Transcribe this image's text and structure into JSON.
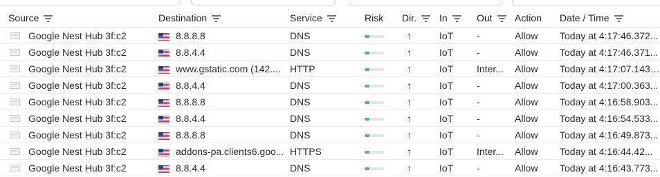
{
  "columns": {
    "source": "Source",
    "destination": "Destination",
    "service": "Service",
    "risk": "Risk",
    "direction": "Dir.",
    "in": "In",
    "out": "Out",
    "action": "Action",
    "datetime": "Date / Time"
  },
  "icons": {
    "filter": "filter-icon",
    "device": "device-icon",
    "flag": "us-flag-icon",
    "direction": "arrow-up-icon"
  },
  "colors": {
    "risk_fill": "#39c45c",
    "risk_track": "#e4e4e4"
  },
  "rows": [
    {
      "source": "Google Nest Hub 3f:c2",
      "destination": "8.8.8.8",
      "service": "DNS",
      "risk": 0.25,
      "direction": "↑",
      "in": "IoT",
      "out": "-",
      "action": "Allow",
      "datetime": "Today at 4:17:46.372..."
    },
    {
      "source": "Google Nest Hub 3f:c2",
      "destination": "8.8.4.4",
      "service": "DNS",
      "risk": 0.25,
      "direction": "↑",
      "in": "IoT",
      "out": "-",
      "action": "Allow",
      "datetime": "Today at 4:17:46.371..."
    },
    {
      "source": "Google Nest Hub 3f:c2",
      "destination": "www.gstatic.com (142....",
      "service": "HTTP",
      "risk": 0.25,
      "direction": "↑",
      "in": "IoT",
      "out": "Inter...",
      "action": "Allow",
      "datetime": "Today at 4:17:07.143 ..."
    },
    {
      "source": "Google Nest Hub 3f:c2",
      "destination": "8.8.4.4",
      "service": "DNS",
      "risk": 0.25,
      "direction": "↑",
      "in": "IoT",
      "out": "-",
      "action": "Allow",
      "datetime": "Today at 4:17:00.363..."
    },
    {
      "source": "Google Nest Hub 3f:c2",
      "destination": "8.8.8.8",
      "service": "DNS",
      "risk": 0.25,
      "direction": "↑",
      "in": "IoT",
      "out": "-",
      "action": "Allow",
      "datetime": "Today at 4:16:58.903..."
    },
    {
      "source": "Google Nest Hub 3f:c2",
      "destination": "8.8.4.4",
      "service": "DNS",
      "risk": 0.25,
      "direction": "↑",
      "in": "IoT",
      "out": "-",
      "action": "Allow",
      "datetime": "Today at 4:16:54.533..."
    },
    {
      "source": "Google Nest Hub 3f:c2",
      "destination": "8.8.8.8",
      "service": "DNS",
      "risk": 0.25,
      "direction": "↑",
      "in": "IoT",
      "out": "-",
      "action": "Allow",
      "datetime": "Today at 4:16:49.873..."
    },
    {
      "source": "Google Nest Hub 3f:c2",
      "destination": "addons-pa.clients6.goo...",
      "service": "HTTPS",
      "risk": 0.25,
      "direction": "↑",
      "in": "IoT",
      "out": "Inter...",
      "action": "Allow",
      "datetime": "Today at 4:16:44.42..."
    },
    {
      "source": "Google Nest Hub 3f:c2",
      "destination": "8.8.4.4",
      "service": "DNS",
      "risk": 0.25,
      "direction": "↑",
      "in": "IoT",
      "out": "-",
      "action": "Allow",
      "datetime": "Today at 4:16:43.773..."
    }
  ]
}
